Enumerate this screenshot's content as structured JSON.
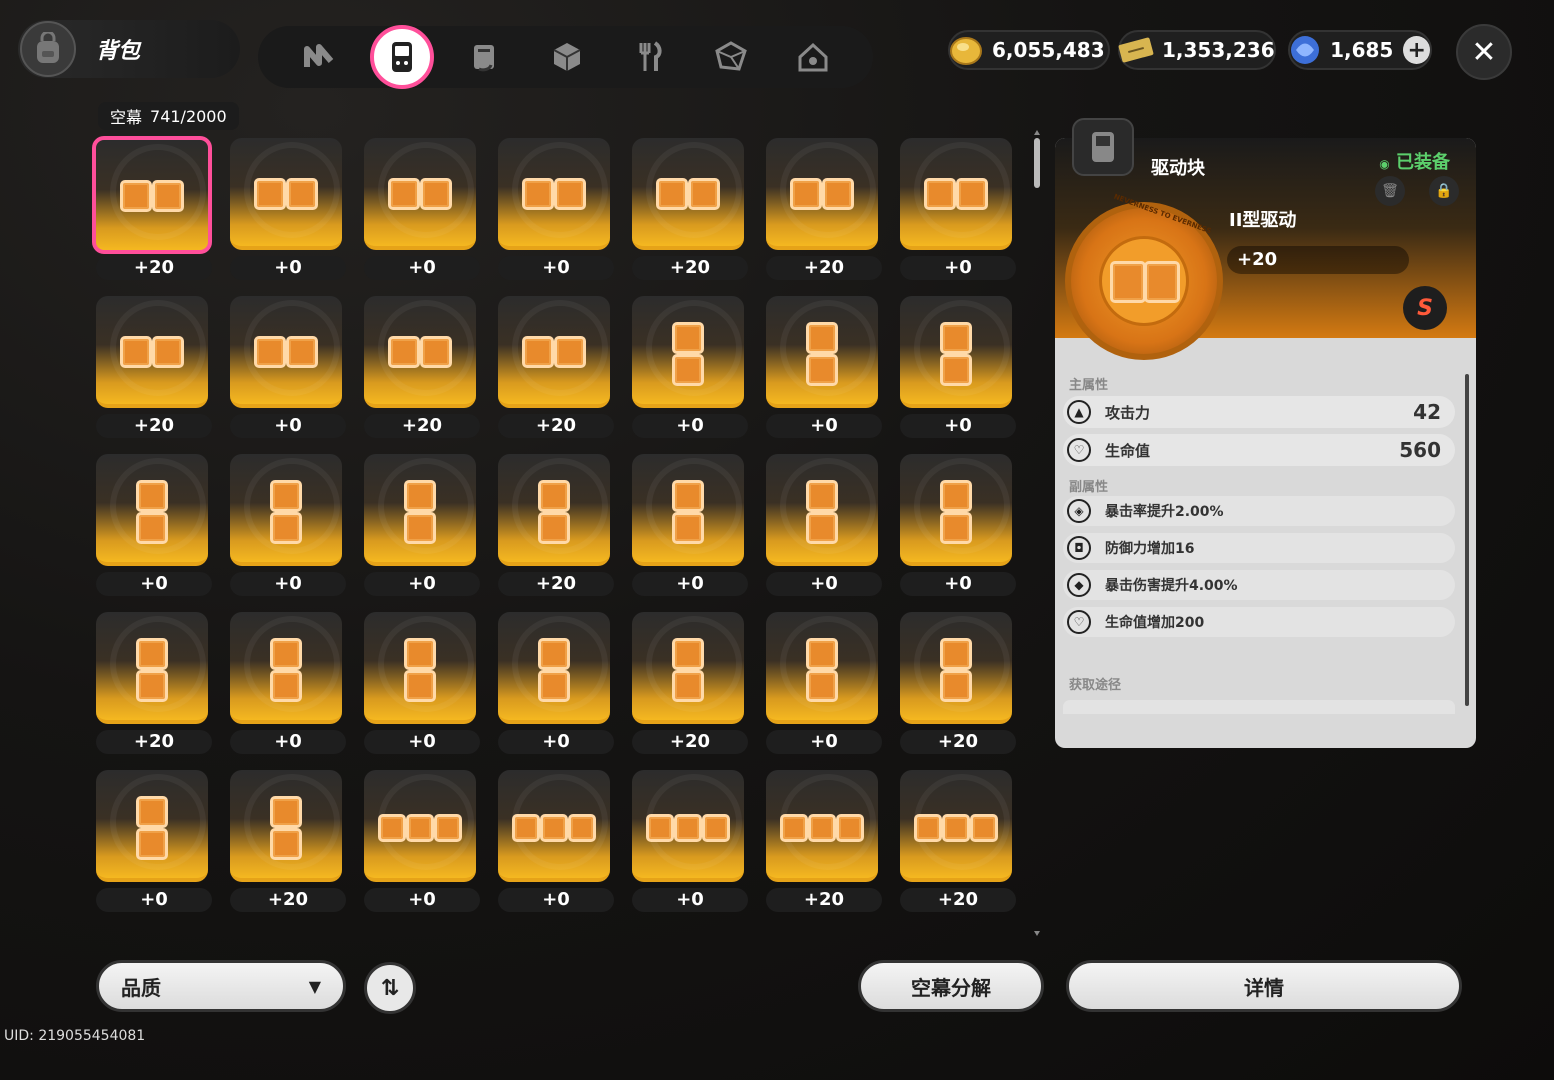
{
  "header": {
    "bag_title": "背包",
    "tabs": [
      {
        "id": "tab-n-mark",
        "icon": "n-mark-icon",
        "active": false
      },
      {
        "id": "tab-drive-disc",
        "icon": "gamepad-device-icon",
        "active": true
      },
      {
        "id": "tab-materials",
        "icon": "book-icon",
        "active": false
      },
      {
        "id": "tab-cube",
        "icon": "cube-icon",
        "active": false
      },
      {
        "id": "tab-food",
        "icon": "fork-knife-icon",
        "active": false
      },
      {
        "id": "tab-dice",
        "icon": "dice-icon",
        "active": false
      },
      {
        "id": "tab-home",
        "icon": "house-icon",
        "active": false
      }
    ]
  },
  "currencies": [
    {
      "name": "gold",
      "icon": "gold-coin-icon",
      "value": "6,055,483"
    },
    {
      "name": "ticket",
      "icon": "ticket-icon",
      "value": "1,353,236"
    },
    {
      "name": "crystal",
      "icon": "crystal-icon",
      "value": "1,685"
    }
  ],
  "inventory": {
    "category_name": "空幕",
    "count": "741/2000",
    "items": [
      {
        "shape": "h2",
        "level": "+20",
        "selected": true
      },
      {
        "shape": "h2",
        "level": "+0"
      },
      {
        "shape": "h2",
        "level": "+0"
      },
      {
        "shape": "h2",
        "level": "+0"
      },
      {
        "shape": "h2",
        "level": "+20"
      },
      {
        "shape": "h2",
        "level": "+20"
      },
      {
        "shape": "h2",
        "level": "+0"
      },
      {
        "shape": "h2",
        "level": "+20"
      },
      {
        "shape": "h2",
        "level": "+0"
      },
      {
        "shape": "h2",
        "level": "+20"
      },
      {
        "shape": "h2",
        "level": "+20"
      },
      {
        "shape": "v2",
        "level": "+0"
      },
      {
        "shape": "v2",
        "level": "+0"
      },
      {
        "shape": "v2",
        "level": "+0"
      },
      {
        "shape": "v2",
        "level": "+0"
      },
      {
        "shape": "v2",
        "level": "+0"
      },
      {
        "shape": "v2",
        "level": "+0"
      },
      {
        "shape": "v2",
        "level": "+20"
      },
      {
        "shape": "v2",
        "level": "+0"
      },
      {
        "shape": "v2",
        "level": "+0"
      },
      {
        "shape": "v2",
        "level": "+0"
      },
      {
        "shape": "v2",
        "level": "+20"
      },
      {
        "shape": "v2",
        "level": "+0"
      },
      {
        "shape": "v2",
        "level": "+0"
      },
      {
        "shape": "v2",
        "level": "+0"
      },
      {
        "shape": "v2",
        "level": "+20"
      },
      {
        "shape": "v2",
        "level": "+0"
      },
      {
        "shape": "v2",
        "level": "+20"
      },
      {
        "shape": "v2",
        "level": "+0"
      },
      {
        "shape": "v2",
        "level": "+20"
      },
      {
        "shape": "h3",
        "level": "+0"
      },
      {
        "shape": "h3",
        "level": "+0"
      },
      {
        "shape": "h3",
        "level": "+0"
      },
      {
        "shape": "h3",
        "level": "+20"
      },
      {
        "shape": "h3",
        "level": "+20"
      }
    ]
  },
  "detail": {
    "category": "驱动块",
    "status": "已装备",
    "item_name": "II型驱动",
    "level": "+20",
    "rank": "S",
    "disc_text": "NEVERNESS TO EVERNESS",
    "main_stats_label": "主属性",
    "main_stats": [
      {
        "icon": "attack-icon",
        "name": "攻击力",
        "value": "42"
      },
      {
        "icon": "heart-icon",
        "name": "生命值",
        "value": "560"
      }
    ],
    "sub_stats_label": "副属性",
    "sub_stats": [
      {
        "icon": "crit-target-icon",
        "name": "暴击率提升2.00%"
      },
      {
        "icon": "shield-icon",
        "name": "防御力增加16"
      },
      {
        "icon": "crit-damage-icon",
        "name": "暴击伤害提升4.00%"
      },
      {
        "icon": "heart-icon",
        "name": "生命值增加200"
      }
    ],
    "source_label": "获取途径"
  },
  "footer": {
    "filter_label": "品质",
    "decompose_label": "空幕分解",
    "details_label": "详情",
    "uid": "UID: 219055454081"
  },
  "colors": {
    "accent_pink": "#ff4f9a",
    "tile_gold": "#f5b820",
    "piece_orange": "#e88a2c",
    "equipped_green": "#5ccf6c"
  }
}
